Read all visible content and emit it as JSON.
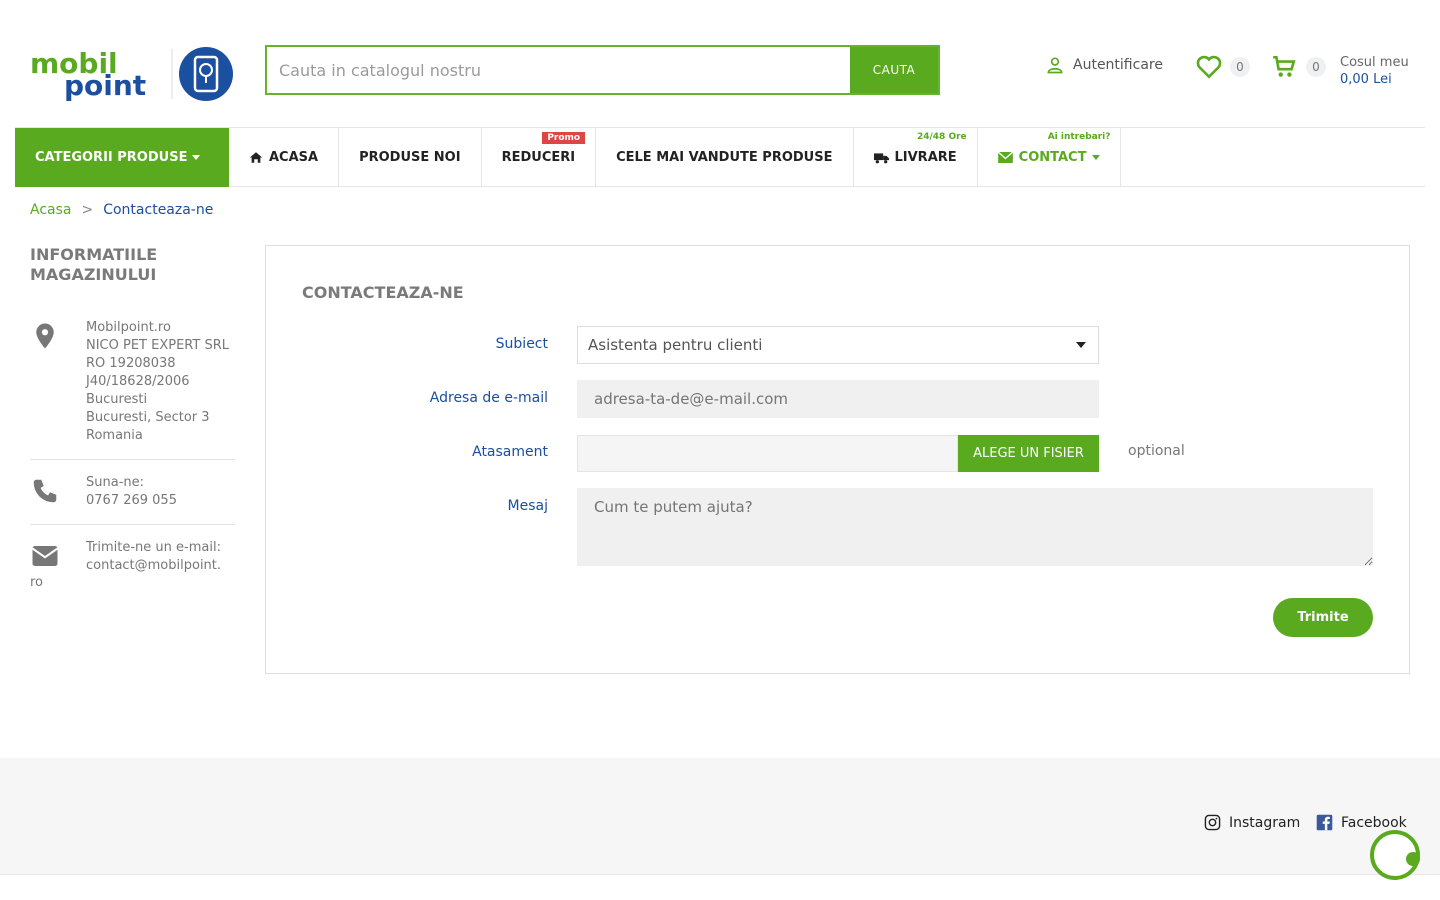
{
  "logo": {
    "line1": "mobil",
    "line2": "point"
  },
  "search": {
    "placeholder": "Cauta in catalogul nostru",
    "button_label": "CAUTA"
  },
  "header": {
    "login_label": "Autentificare",
    "wishlist_count": "0",
    "cart_count": "0",
    "cart_title": "Cosul meu",
    "cart_total": "0,00 Lei"
  },
  "nav": {
    "categories_label": "CATEGORII PRODUSE",
    "items": [
      {
        "label": "ACASA"
      },
      {
        "label": "PRODUSE NOI"
      },
      {
        "label": "REDUCERI",
        "tag": "Promo"
      },
      {
        "label": "CELE MAI VANDUTE PRODUSE"
      },
      {
        "label": "LIVRARE",
        "tag": "24/48 Ore"
      },
      {
        "label": "CONTACT",
        "tag": "Ai intrebari?"
      }
    ]
  },
  "breadcrumb": {
    "home": "Acasa",
    "separator": ">",
    "current": "Contacteaza-ne"
  },
  "sidebar": {
    "title": "INFORMATIILE MAGAZINULUI",
    "address_lines": [
      "Mobilpoint.ro",
      "NICO PET EXPERT SRL",
      "RO 19208038",
      "J40/18628/2006",
      "Bucuresti",
      "Bucuresti, Sector 3",
      "Romania"
    ],
    "phone_label": "Suna-ne:",
    "phone": "0767 269 055",
    "email_label": "Trimite-ne un e-mail:",
    "email_part1": "contact@mobilpoint.",
    "email_part2": "ro"
  },
  "form": {
    "title": "CONTACTEAZA-NE",
    "subject_label": "Subiect",
    "subject_value": "Asistenta pentru clienti",
    "email_label": "Adresa de e-mail",
    "email_placeholder": "adresa-ta-de@e-mail.com",
    "attachment_label": "Atasament",
    "file_button": "ALEGE UN FISIER",
    "optional": "optional",
    "message_label": "Mesaj",
    "message_placeholder": "Cum te putem ajuta?",
    "submit": "Trimite"
  },
  "footer": {
    "instagram": "Instagram",
    "facebook": "Facebook"
  },
  "colors": {
    "brand_green": "#5aaa1f",
    "brand_blue": "#1b4fa0",
    "promo_red": "#e04545"
  }
}
